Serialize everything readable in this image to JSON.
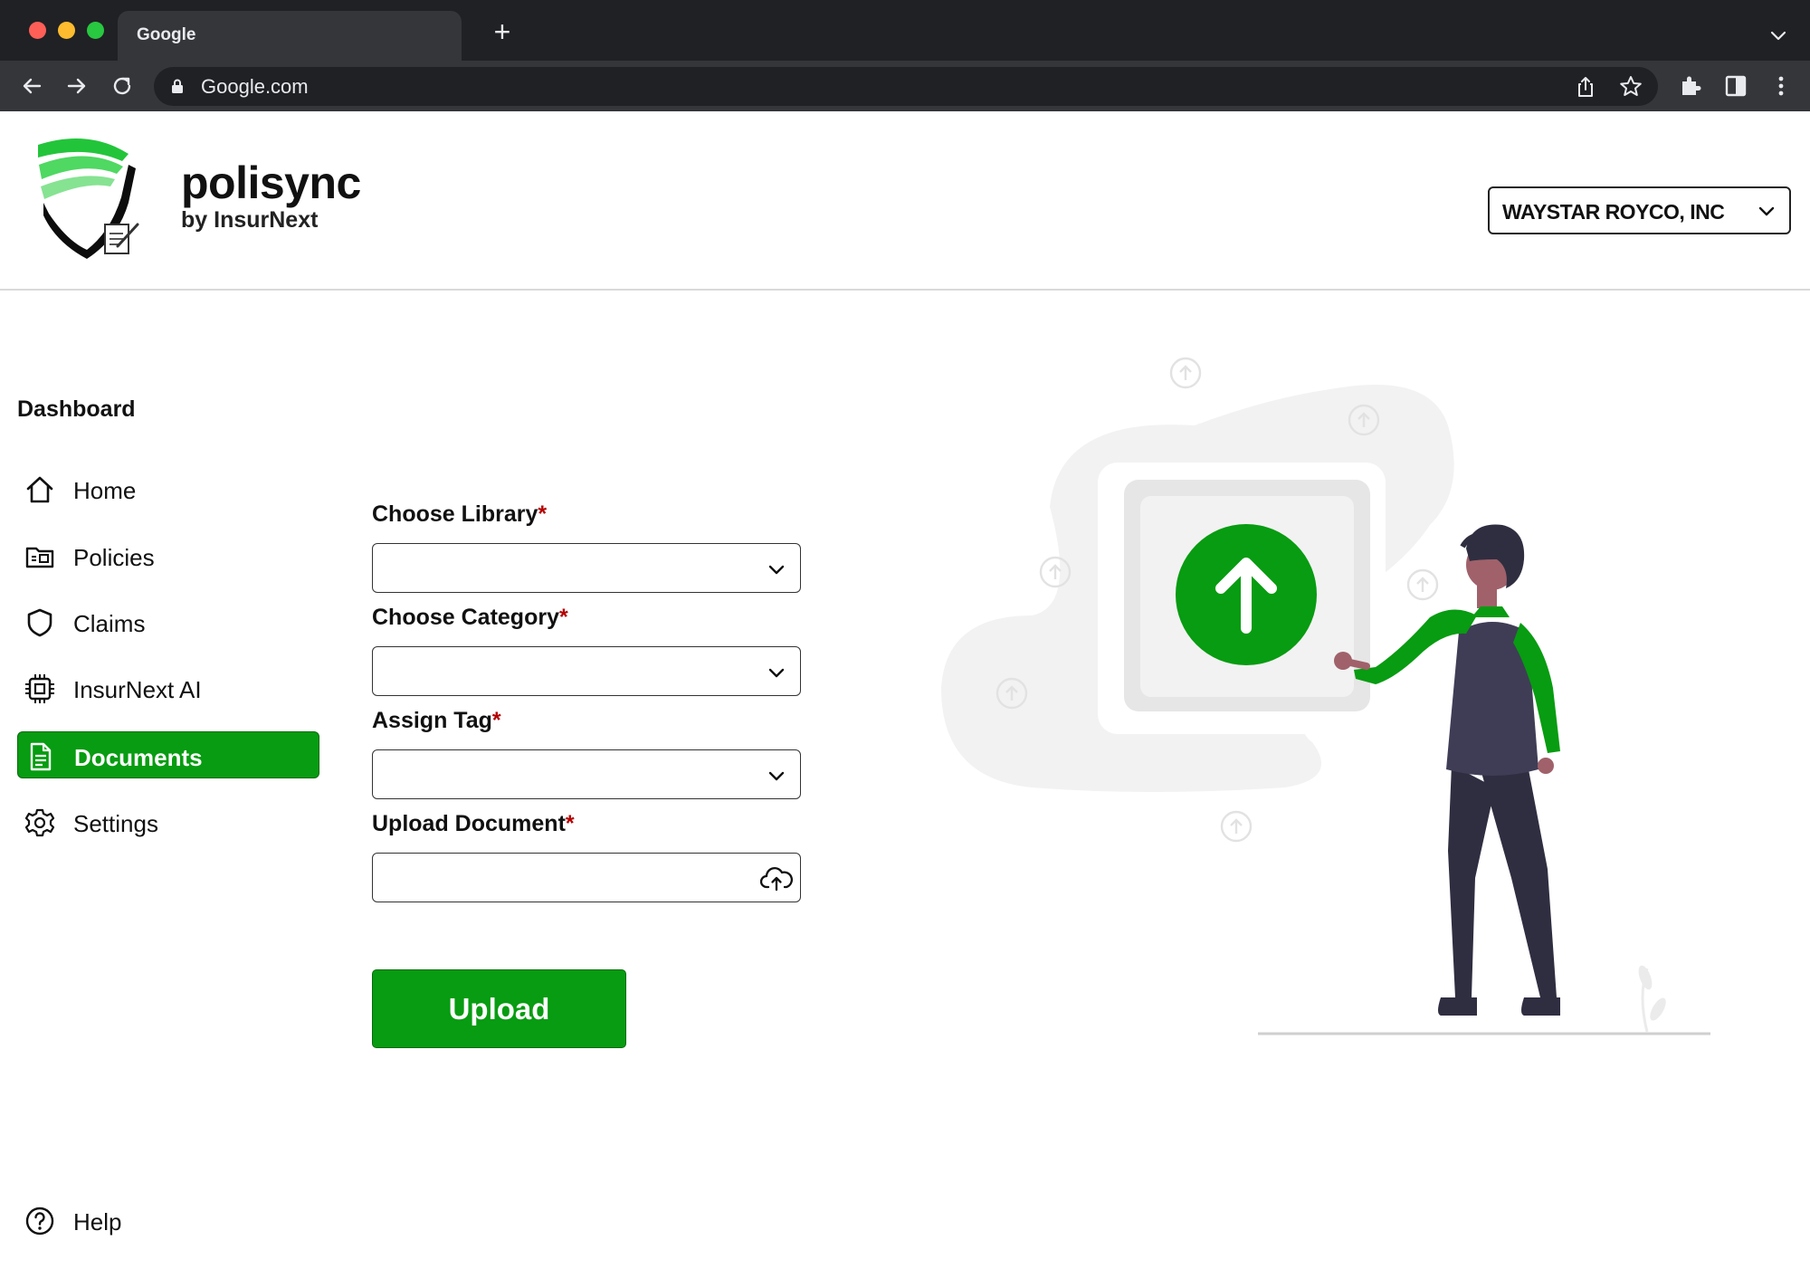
{
  "browser": {
    "tab_title": "Google",
    "new_tab_symbol": "+",
    "url": "Google.com",
    "icons": [
      "back-icon",
      "forward-icon",
      "reload-icon",
      "lock-icon",
      "share-icon",
      "star-icon",
      "extensions-icon",
      "side-panel-icon",
      "menu-icon",
      "chevron-down-icon"
    ]
  },
  "header": {
    "brand_name": "polisync",
    "brand_sub": "by InsurNext",
    "org_selected": "WAYSTAR ROYCO, INC"
  },
  "sidebar": {
    "title": "Dashboard",
    "items": [
      {
        "label": "Home",
        "icon": "home-icon",
        "active": false
      },
      {
        "label": "Policies",
        "icon": "folder-icon",
        "active": false
      },
      {
        "label": "Claims",
        "icon": "shield-icon",
        "active": false
      },
      {
        "label": "InsurNext AI",
        "icon": "chip-icon",
        "active": false
      },
      {
        "label": "Documents",
        "icon": "document-icon",
        "active": true
      },
      {
        "label": "Settings",
        "icon": "gear-icon",
        "active": false
      }
    ],
    "help_label": "Help"
  },
  "form": {
    "required_mark": "*",
    "library_label": "Choose Library",
    "library_value": "",
    "category_label": "Choose Category",
    "category_value": "",
    "tag_label": "Assign Tag",
    "tag_value": "",
    "upload_label": "Upload Document",
    "upload_value": "",
    "upload_button": "Upload"
  },
  "colors": {
    "accent": "#079c11",
    "chrome_dark": "#202124",
    "chrome_toolbar": "#35363a",
    "required": "#b30000"
  }
}
